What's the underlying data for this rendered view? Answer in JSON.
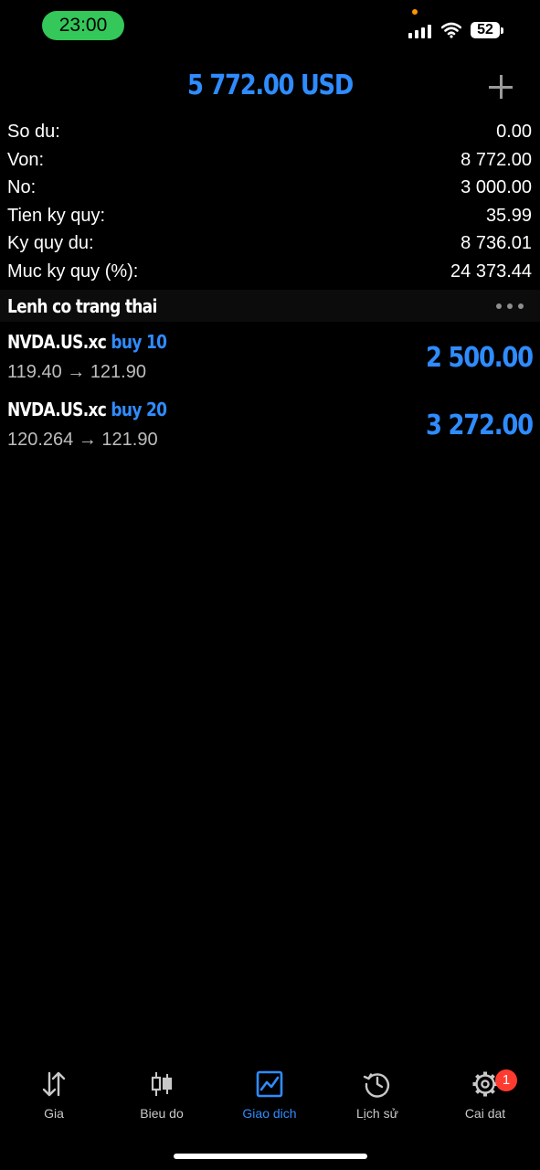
{
  "status_bar": {
    "time": "23:00",
    "battery": "52"
  },
  "header": {
    "title": "5 772.00 USD"
  },
  "summary": [
    {
      "label": "So du:",
      "value": "0.00"
    },
    {
      "label": "Von:",
      "value": "8 772.00"
    },
    {
      "label": "No:",
      "value": "3 000.00"
    },
    {
      "label": "Tien ky quy:",
      "value": "35.99"
    },
    {
      "label": "Ky quy du:",
      "value": "8 736.01"
    },
    {
      "label": "Muc ky quy (%):",
      "value": "24 373.44"
    }
  ],
  "section": {
    "title": "Lenh co trang thai"
  },
  "positions": [
    {
      "symbol": "NVDA.US.xc",
      "side": "buy 10",
      "open_price": "119.40",
      "arrow": "→",
      "current_price": "121.90",
      "profit": "2 500.00"
    },
    {
      "symbol": "NVDA.US.xc",
      "side": "buy 20",
      "open_price": "120.264",
      "arrow": "→",
      "current_price": "121.90",
      "profit": "3 272.00"
    }
  ],
  "tabbar": {
    "tabs": [
      {
        "label": "Gia",
        "icon": "arrows-up-down-icon"
      },
      {
        "label": "Bieu do",
        "icon": "candlestick-icon"
      },
      {
        "label": "Giao dich",
        "icon": "trade-chart-icon",
        "active": true
      },
      {
        "label": "Lịch sử",
        "icon": "history-clock-icon"
      },
      {
        "label": "Cai dat",
        "icon": "gear-icon",
        "badge": "1"
      }
    ]
  },
  "colors": {
    "accent": "#2f8cff",
    "background": "#000000",
    "badge": "#ff3b30",
    "time_pill": "#34c759"
  }
}
